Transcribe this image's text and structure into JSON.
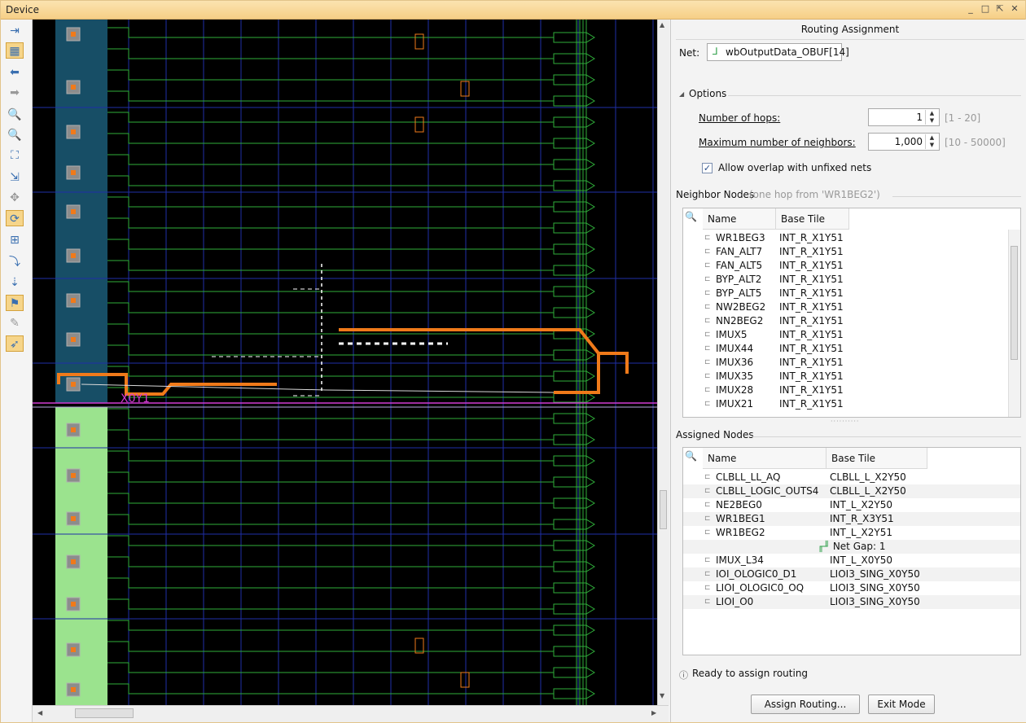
{
  "window": {
    "title": "Device"
  },
  "canvas": {
    "site_label": "X0Y1"
  },
  "panel": {
    "title": "Routing Assignment",
    "net_label": "Net:",
    "net_value": "wbOutputData_OBUF[14]",
    "options_label": "Options",
    "hops": {
      "label": "Number of hops:",
      "value": "1",
      "range": "[1 - 20]"
    },
    "neighbors": {
      "label": "Maximum number of neighbors:",
      "value": "1,000",
      "range": "[10 - 50000]"
    },
    "overlap": {
      "label": "Allow overlap with unfixed nets",
      "checked": true
    },
    "neighbor_nodes": {
      "title": "Neighbor Nodes",
      "subtitle": "(one hop from 'WR1BEG2')",
      "columns": [
        "Name",
        "Base Tile"
      ],
      "rows": [
        [
          "WR1BEG3",
          "INT_R_X1Y51"
        ],
        [
          "FAN_ALT7",
          "INT_R_X1Y51"
        ],
        [
          "FAN_ALT5",
          "INT_R_X1Y51"
        ],
        [
          "BYP_ALT2",
          "INT_R_X1Y51"
        ],
        [
          "BYP_ALT5",
          "INT_R_X1Y51"
        ],
        [
          "NW2BEG2",
          "INT_R_X1Y51"
        ],
        [
          "NN2BEG2",
          "INT_R_X1Y51"
        ],
        [
          "IMUX5",
          "INT_R_X1Y51"
        ],
        [
          "IMUX44",
          "INT_R_X1Y51"
        ],
        [
          "IMUX36",
          "INT_R_X1Y51"
        ],
        [
          "IMUX35",
          "INT_R_X1Y51"
        ],
        [
          "IMUX28",
          "INT_R_X1Y51"
        ],
        [
          "IMUX21",
          "INT_R_X1Y51"
        ]
      ]
    },
    "assigned_nodes": {
      "title": "Assigned Nodes",
      "columns": [
        "Name",
        "Base Tile"
      ],
      "rows": [
        [
          "CLBLL_LL_AQ",
          "CLBLL_L_X2Y50"
        ],
        [
          "CLBLL_LOGIC_OUTS4",
          "CLBLL_L_X2Y50"
        ],
        [
          "NE2BEG0",
          "INT_L_X2Y50"
        ],
        [
          "WR1BEG1",
          "INT_R_X3Y51"
        ],
        [
          "WR1BEG2",
          "INT_L_X2Y51"
        ]
      ],
      "gap": "Net Gap: 1",
      "rows_after": [
        [
          "IMUX_L34",
          "INT_L_X0Y50"
        ],
        [
          "IOI_OLOGIC0_D1",
          "LIOI3_SING_X0Y50"
        ],
        [
          "LIOI_OLOGIC0_OQ",
          "LIOI3_SING_X0Y50"
        ],
        [
          "LIOI_O0",
          "LIOI3_SING_X0Y50"
        ]
      ]
    },
    "status": "Ready to assign routing",
    "assign_button": "Assign Routing...",
    "exit_button": "Exit Mode"
  },
  "colors": {
    "route": "#f07a1a",
    "wire": "#2fae3a",
    "grid": "#1f2fa8",
    "tile_blue": "#174e66",
    "tile_green": "#9be38e",
    "site_label": "#d23ad2"
  }
}
